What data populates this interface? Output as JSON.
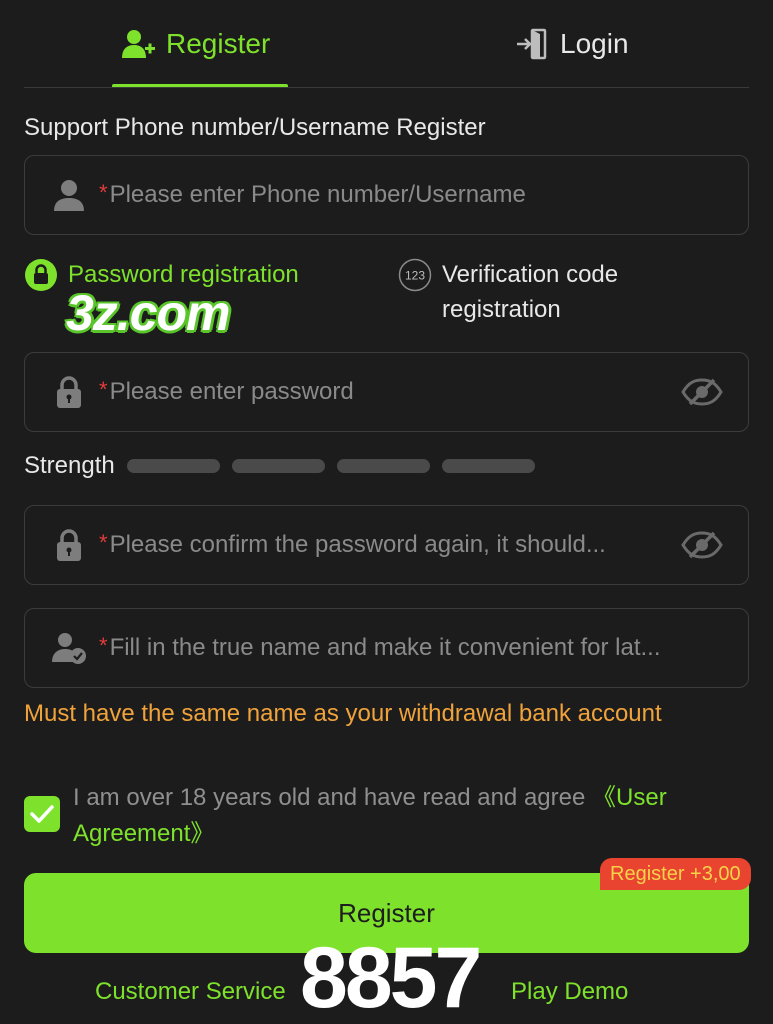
{
  "tabs": {
    "register_label": "Register",
    "login_label": "Login"
  },
  "form": {
    "section_label": "Support Phone number/Username Register",
    "username_placeholder": "Please enter Phone number/Username",
    "password_placeholder": "Please enter password",
    "confirm_placeholder": "Please confirm the password again, it should...",
    "realname_placeholder": "Fill in the true name and make it convenient for lat...",
    "required_mark": "*"
  },
  "modes": {
    "password_label": "Password registration",
    "code_label": "Verification code registration",
    "code_icon_text": "123"
  },
  "watermark": "3z.com",
  "strength": {
    "label": "Strength",
    "bars": 4
  },
  "hint": "Must have the same name as your withdrawal bank account",
  "agreement": {
    "text": "I am over 18 years old and have read and agree",
    "link": "《User Agreement》",
    "checked": true
  },
  "register_button": "Register",
  "bonus_badge": "Register +3,00",
  "footer": {
    "customer_service": "Customer Service",
    "play_demo": "Play Demo"
  },
  "overlay_number": "8857",
  "colors": {
    "accent": "#7ee22c",
    "background": "#1c1c1c",
    "warning": "#f0a33b",
    "required": "#e23b3b",
    "badge": "#e8442f"
  }
}
